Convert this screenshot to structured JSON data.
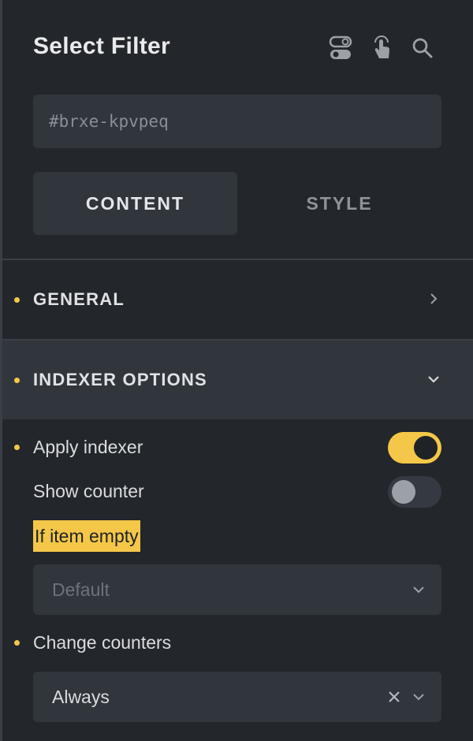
{
  "panel": {
    "title": "Select Filter",
    "icons": [
      "toggle-icon",
      "touch-icon",
      "search-icon"
    ],
    "element_id": "#brxe-kpvpeq"
  },
  "tabs": [
    {
      "label": "CONTENT",
      "active": true
    },
    {
      "label": "STYLE",
      "active": false
    }
  ],
  "sections": {
    "general": {
      "label": "GENERAL",
      "expanded": false
    },
    "indexer": {
      "label": "INDEXER OPTIONS",
      "expanded": true
    }
  },
  "indexer_options": {
    "apply_indexer": {
      "label": "Apply indexer",
      "value": true
    },
    "show_counter": {
      "label": "Show counter",
      "value": false
    },
    "if_item_empty": {
      "label": "If item empty",
      "placeholder": "Default"
    },
    "change_counters": {
      "label": "Change counters",
      "value": "Always"
    }
  },
  "colors": {
    "accent": "#f4c748",
    "panel_bg": "#23262b",
    "field_bg": "#31353c"
  }
}
